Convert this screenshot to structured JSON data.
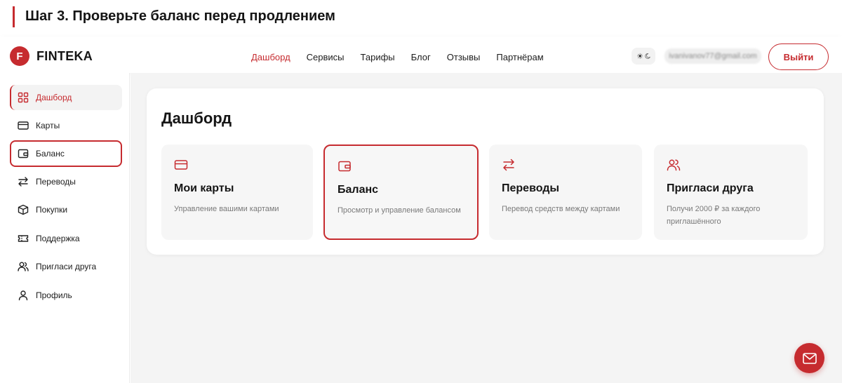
{
  "banner": {
    "title": "Шаг 3. Проверьте баланс перед продлением"
  },
  "brand": {
    "mark": "F",
    "name": "FINTEKA",
    "accent": "#c62b2f"
  },
  "nav": {
    "items": [
      {
        "label": "Дашборд",
        "active": true
      },
      {
        "label": "Сервисы"
      },
      {
        "label": "Тарифы"
      },
      {
        "label": "Блог"
      },
      {
        "label": "Отзывы"
      },
      {
        "label": "Партнёрам"
      }
    ]
  },
  "header": {
    "theme_icon": "☀",
    "user_email": "ivanivanov77@gmail.com",
    "logout_label": "Выйти"
  },
  "sidebar": {
    "items": [
      {
        "label": "Дашборд",
        "icon": "grid-icon",
        "active": true
      },
      {
        "label": "Карты",
        "icon": "card-icon"
      },
      {
        "label": "Баланс",
        "icon": "wallet-icon",
        "highlighted": true
      },
      {
        "label": "Переводы",
        "icon": "transfer-icon"
      },
      {
        "label": "Покупки",
        "icon": "box-icon"
      },
      {
        "label": "Поддержка",
        "icon": "ticket-icon"
      },
      {
        "label": "Пригласи друга",
        "icon": "users-icon"
      },
      {
        "label": "Профиль",
        "icon": "user-icon"
      }
    ]
  },
  "main": {
    "title": "Дашборд",
    "cards": [
      {
        "title": "Мои карты",
        "desc": "Управление вашими картами",
        "icon": "card-icon"
      },
      {
        "title": "Баланс",
        "desc": "Просмотр и управление балансом",
        "icon": "wallet-icon",
        "highlighted": true
      },
      {
        "title": "Переводы",
        "desc": "Перевод средств между картами",
        "icon": "transfer-icon"
      },
      {
        "title": "Пригласи друга",
        "desc": "Получи 2000 ₽ за каждого приглашённого",
        "icon": "users-icon"
      }
    ]
  },
  "fab": {
    "icon": "mail-icon"
  }
}
